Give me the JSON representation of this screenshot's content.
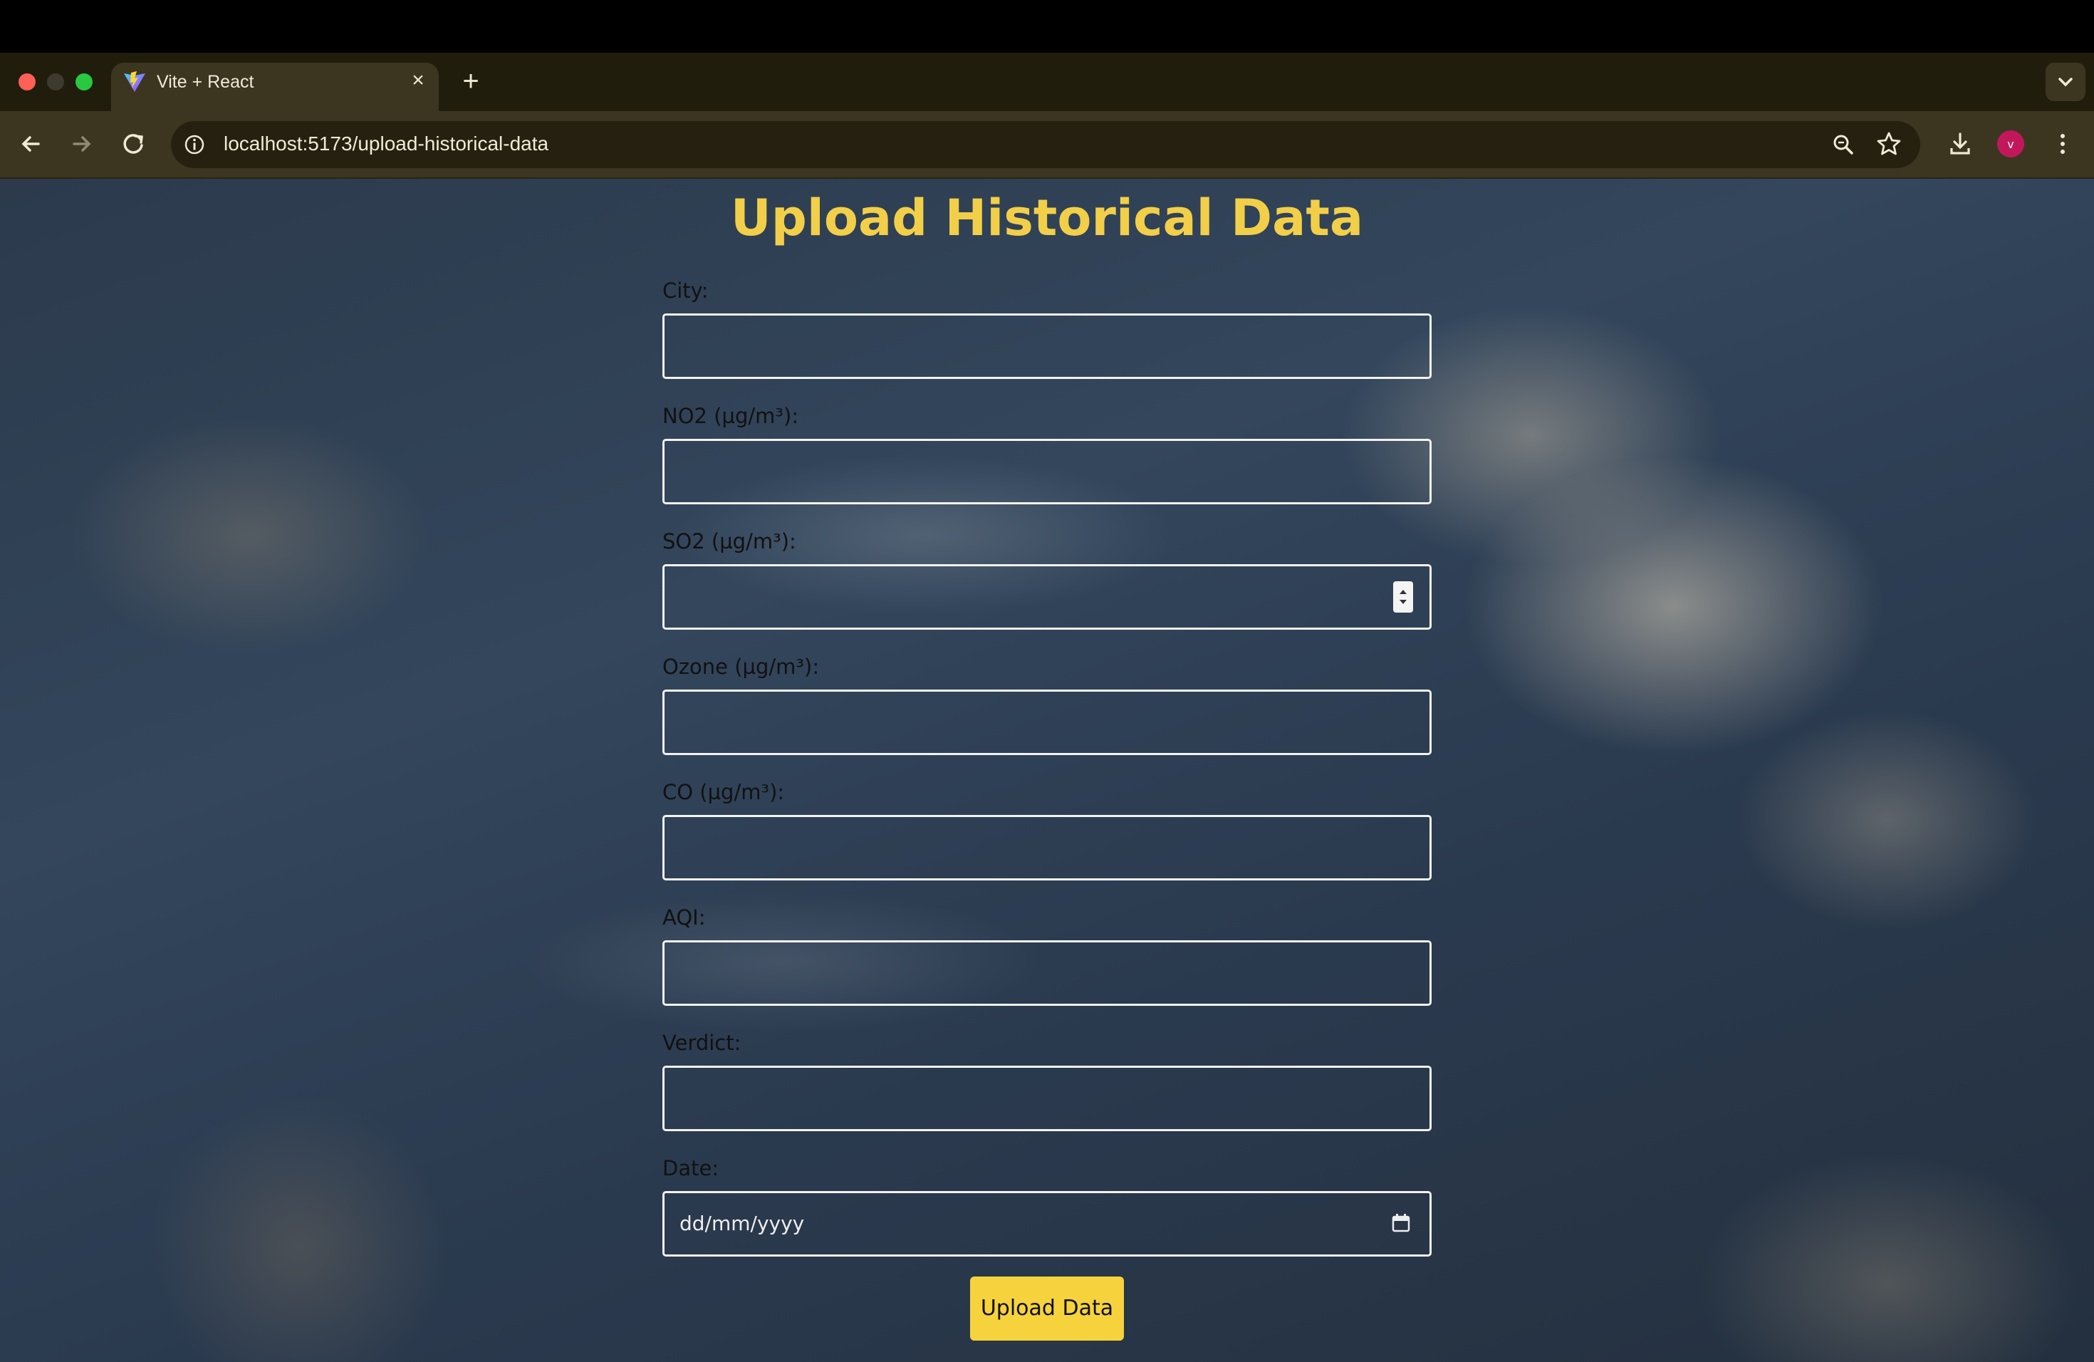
{
  "browser": {
    "tab": {
      "title": "Vite + React",
      "favicon": "vite-logo-icon"
    },
    "url": "localhost:5173/upload-historical-data",
    "profile_initial": "v",
    "icons": [
      "back-arrow-icon",
      "forward-arrow-icon",
      "reload-icon",
      "info-icon",
      "zoom-icon",
      "star-icon",
      "download-icon",
      "menu-dots-icon",
      "tab-list-chevron-icon"
    ]
  },
  "page": {
    "title": "Upload Historical Data",
    "fields": {
      "city": {
        "label": "City:",
        "value": ""
      },
      "no2": {
        "label": "NO2 (µg/m³):",
        "value": ""
      },
      "so2": {
        "label": "SO2 (µg/m³):",
        "value": ""
      },
      "ozone": {
        "label": "Ozone (µg/m³):",
        "value": ""
      },
      "co": {
        "label": "CO (µg/m³):",
        "value": ""
      },
      "aqi": {
        "label": "AQI:",
        "value": ""
      },
      "verdict": {
        "label": "Verdict:",
        "value": ""
      },
      "date": {
        "label": "Date:",
        "placeholder": "dd/mm/yyyy"
      }
    },
    "submit_label": "Upload Data"
  },
  "colors": {
    "title": "#f2cf48",
    "button": "#f6d33c",
    "browser_frame": "#3c3620",
    "tab_strip": "#211d0d"
  }
}
